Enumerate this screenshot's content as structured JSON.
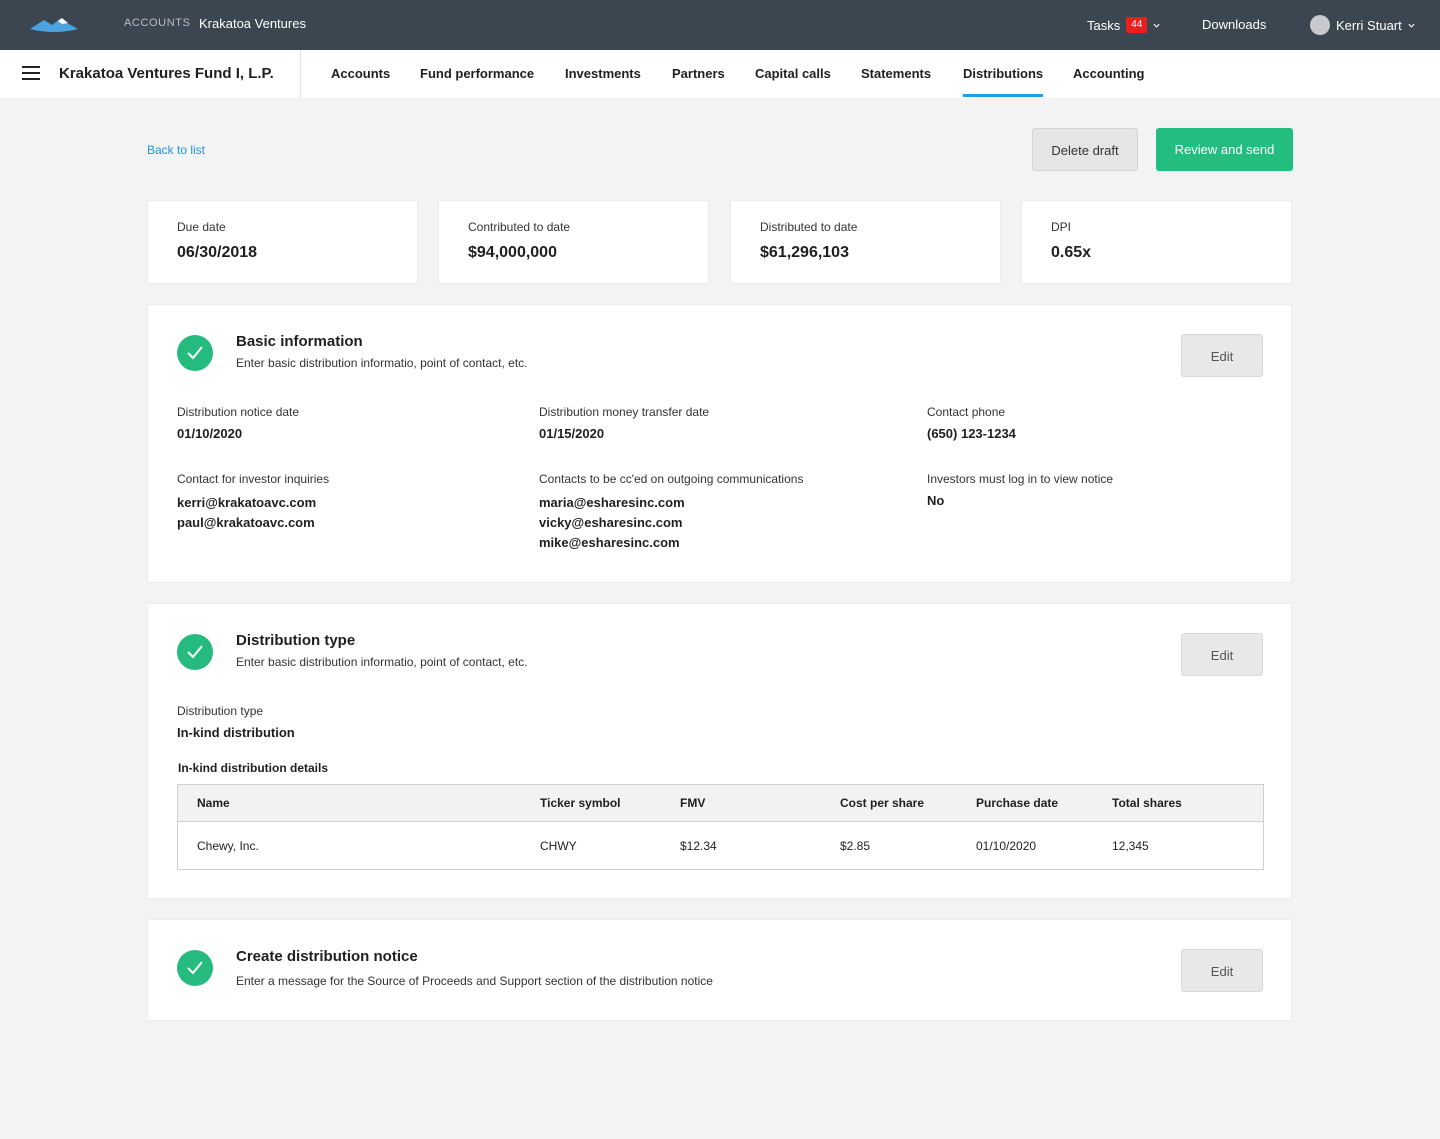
{
  "topbar": {
    "section_label": "ACCOUNTS",
    "account_name": "Krakatoa Ventures",
    "tasks_label": "Tasks",
    "tasks_count": "44",
    "downloads_label": "Downloads",
    "user_name": "Kerri Stuart"
  },
  "subnav": {
    "fund_title": "Krakatoa Ventures Fund I, L.P.",
    "tabs": [
      "Accounts",
      "Fund performance",
      "Investments",
      "Partners",
      "Capital calls",
      "Statements",
      "Distributions",
      "Accounting"
    ],
    "active_tab": "Distributions"
  },
  "actions": {
    "back_label": "Back to list",
    "delete_label": "Delete draft",
    "review_label": "Review and send"
  },
  "stats": [
    {
      "label": "Due date",
      "value": "06/30/2018"
    },
    {
      "label": "Contributed to date",
      "value": "$94,000,000"
    },
    {
      "label": "Distributed to date",
      "value": "$61,296,103"
    },
    {
      "label": "DPI",
      "value": "0.65x"
    }
  ],
  "basic_info": {
    "title": "Basic information",
    "subtitle": "Enter basic distribution informatio, point of contact, etc.",
    "edit_label": "Edit",
    "notice_date_label": "Distribution notice date",
    "notice_date": "01/10/2020",
    "transfer_date_label": "Distribution money transfer date",
    "transfer_date": "01/15/2020",
    "phone_label": "Contact phone",
    "phone": "(650) 123-1234",
    "inquiries_label": "Contact for investor inquiries",
    "inquiries": [
      "kerri@krakatoavc.com",
      "paul@krakatoavc.com"
    ],
    "cc_label": "Contacts to be cc'ed on outgoing communications",
    "cc": [
      "maria@esharesinc.com",
      "vicky@esharesinc.com",
      "mike@esharesinc.com"
    ],
    "login_label": "Investors must log in to view notice",
    "login_value": "No"
  },
  "dist_type": {
    "title": "Distribution type",
    "subtitle": "Enter basic distribution informatio, point of contact, etc.",
    "edit_label": "Edit",
    "type_label": "Distribution type",
    "type_value": "In-kind distribution",
    "table_title": "In-kind distribution details",
    "columns": [
      "Name",
      "Ticker symbol",
      "FMV",
      "Cost per share",
      "Purchase date",
      "Total shares"
    ],
    "rows": [
      [
        "Chewy, Inc.",
        "CHWY",
        "$12.34",
        "$2.85",
        "01/10/2020",
        "12,345"
      ]
    ]
  },
  "notice": {
    "title": "Create distribution notice",
    "subtitle": "Enter a message for the Source of Proceeds and Support section of the distribution notice",
    "edit_label": "Edit"
  },
  "colors": {
    "topbar": "#3c4650",
    "accent_green": "#23bd80",
    "link_blue": "#1a97dc",
    "badge_red": "#e8211f"
  }
}
